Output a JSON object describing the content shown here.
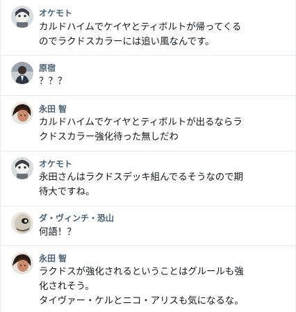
{
  "messages": [
    {
      "author": "オケモト",
      "avatar_icon": "robot-face-avatar",
      "lines": [
        "カルドハイムでケイヤとティボルトが帰ってくる",
        "のでラクドスカラーには追い風なんです。"
      ]
    },
    {
      "author": "原宿",
      "avatar_icon": "person-suit-avatar",
      "lines": [
        "？？？"
      ]
    },
    {
      "author": "永田 智",
      "avatar_icon": "dark-haired-person-avatar",
      "lines": [
        "カルドハイムでケイヤとティボルトが出るならラ",
        "クドスカラー強化待った無しだわ"
      ]
    },
    {
      "author": "オケモト",
      "avatar_icon": "robot-face-avatar",
      "lines": [
        "永田さんはラクドスデッキ組んでるそうなので期",
        "待大ですね。"
      ]
    },
    {
      "author": "ダ・ヴィンチ・恐山",
      "avatar_icon": "masked-face-avatar",
      "lines": [
        "何語！？"
      ]
    },
    {
      "author": "永田 智",
      "avatar_icon": "dark-haired-person-avatar",
      "lines": [
        "ラクドスが強化されるということはグルールも強",
        "化されそう。",
        "タイヴァー・ケルとニコ・アリスも気になるな。"
      ]
    }
  ],
  "colors": {
    "author_name": "#4a6174",
    "message_text": "#14171a",
    "divider": "#e6ecf0"
  }
}
